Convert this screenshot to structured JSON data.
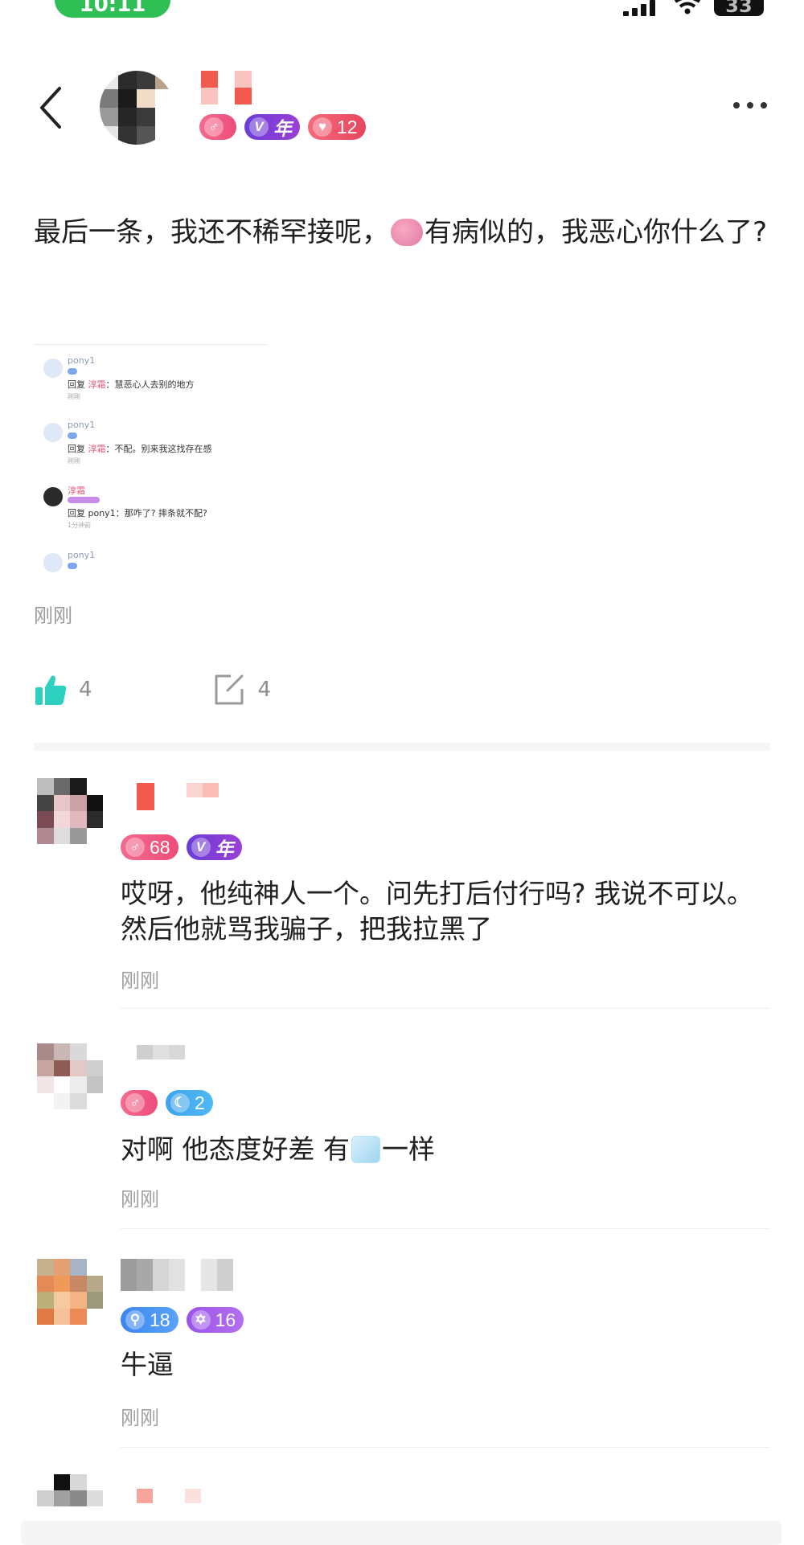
{
  "status_bar": {
    "time": "10:11",
    "battery": "33"
  },
  "header": {
    "badges": [
      {
        "kind": "gender",
        "value": ""
      },
      {
        "kind": "vip",
        "value": "年"
      },
      {
        "kind": "heart",
        "value": "12"
      }
    ]
  },
  "post": {
    "text_before_emoji": "最后一条，我还不稀罕接呢，",
    "emoji_name": "brain",
    "text_after_emoji": "有病似的，我恶心你什么了?",
    "screenshot": {
      "rows": [
        {
          "name": "pony1",
          "reply_prefix": "回复",
          "reply_target": "淳霜",
          "reply_text": "：慧恶心人去别的地方",
          "time": "刚刚"
        },
        {
          "name": "pony1",
          "reply_prefix": "回复",
          "reply_target": "淳霜",
          "reply_text": "：不配。别来我这找存在感",
          "time": "刚刚"
        },
        {
          "name": "淳霜",
          "reply_prefix": "回复",
          "reply_target": "pony1",
          "reply_text": "：那咋了? 摔条就不配?",
          "time": "1分钟前"
        },
        {
          "name": "pony1",
          "reply_prefix": "",
          "reply_target": "",
          "reply_text": "",
          "time": ""
        }
      ]
    },
    "time": "刚刚",
    "likes": "4",
    "comments": "4"
  },
  "comments": [
    {
      "badges": [
        {
          "kind": "gender",
          "value": "68"
        },
        {
          "kind": "vip",
          "value": "年"
        }
      ],
      "text": "哎呀，他纯神人一个。问先打后付行吗? 我说不可以。然后他就骂我骗子，把我拉黑了",
      "time": "刚刚"
    },
    {
      "badges": [
        {
          "kind": "gender",
          "value": ""
        },
        {
          "kind": "moon",
          "value": "2"
        }
      ],
      "text_before_emoji": "对啊 他态度好差 有",
      "emoji_name": "ice",
      "text_after_emoji": "一样",
      "time": "刚刚"
    },
    {
      "badges": [
        {
          "kind": "key",
          "value": "18"
        },
        {
          "kind": "star",
          "value": "16"
        }
      ],
      "text": "牛逼",
      "time": "刚刚"
    }
  ],
  "colors": {
    "accent_like": "#2ed0c0",
    "time_gray": "#9a9a9a"
  }
}
